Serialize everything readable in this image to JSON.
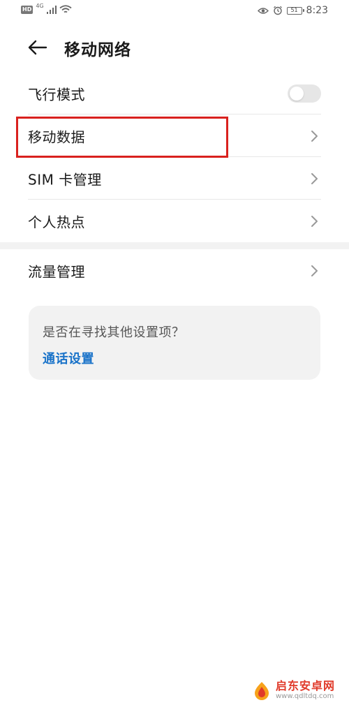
{
  "status_bar": {
    "hd": "HD",
    "network": "4G",
    "battery": "51",
    "time": "8:23"
  },
  "header": {
    "title": "移动网络"
  },
  "settings": {
    "airplane_mode": {
      "label": "飞行模式",
      "enabled": false
    },
    "mobile_data": {
      "label": "移动数据"
    },
    "sim_management": {
      "label": "SIM 卡管理"
    },
    "hotspot": {
      "label": "个人热点"
    },
    "data_usage": {
      "label": "流量管理"
    }
  },
  "suggestion_card": {
    "question": "是否在寻找其他设置项？",
    "link": "通话设置"
  },
  "watermark": {
    "title": "启东安卓网",
    "url": "www.qdltdq.com"
  },
  "colors": {
    "highlight": "#d9211e",
    "link": "#1a73c9",
    "toggle_off": "#e6e6e6"
  }
}
